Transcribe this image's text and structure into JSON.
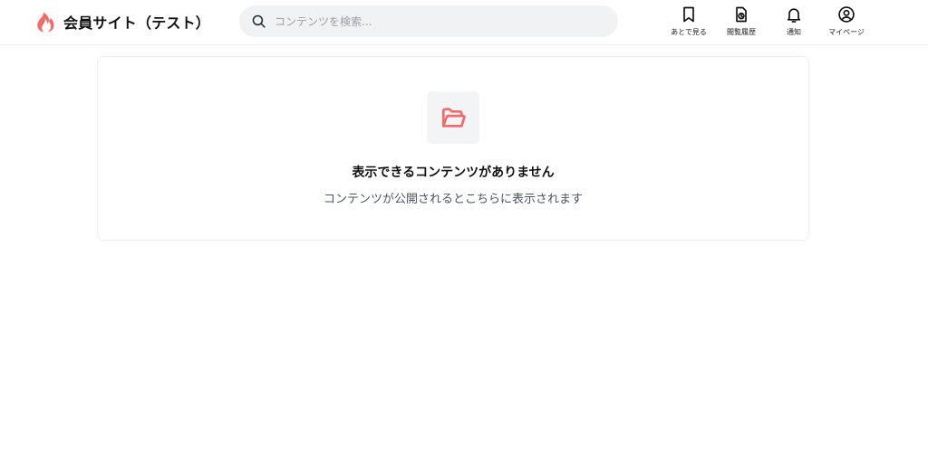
{
  "header": {
    "site_name": "会員サイト（テスト）",
    "brand_color": "#f26b6b",
    "search": {
      "placeholder": "コンテンツを検索..."
    },
    "nav": [
      {
        "label": "あとで見る",
        "icon": "bookmark-icon"
      },
      {
        "label": "閲覧履歴",
        "icon": "history-icon"
      },
      {
        "label": "通知",
        "icon": "bell-icon"
      },
      {
        "label": "マイページ",
        "icon": "user-circle-icon"
      }
    ]
  },
  "main": {
    "empty_state": {
      "icon": "folder-open-icon",
      "title": "表示できるコンテンツがありません",
      "description": "コンテンツが公開されるとこちらに表示されます"
    }
  }
}
